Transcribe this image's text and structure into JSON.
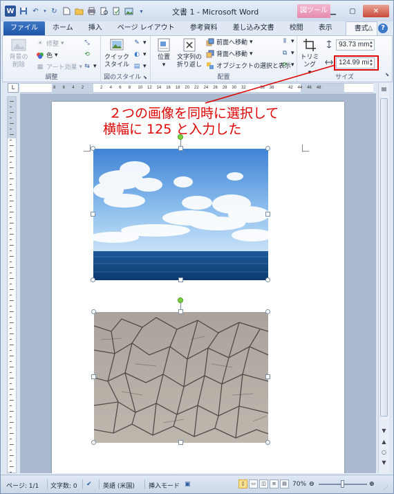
{
  "window": {
    "title": "文書 1 - Microsoft Word",
    "context_tab_title": "図ツール",
    "app_icon": "W"
  },
  "tabs": [
    {
      "label": "ファイル"
    },
    {
      "label": "ホーム"
    },
    {
      "label": "挿入"
    },
    {
      "label": "ページ レイアウト"
    },
    {
      "label": "参考資料"
    },
    {
      "label": "差し込み文書"
    },
    {
      "label": "校閲"
    },
    {
      "label": "表示"
    },
    {
      "label": "書式"
    }
  ],
  "ribbon": {
    "adjust": {
      "remove_bg": "背景の\n削除",
      "corrections": "修整",
      "color": "色",
      "artistic": "アート効果",
      "label": "調整"
    },
    "styles": {
      "quick_styles": "クイック\nスタイル",
      "label": "図のスタイル"
    },
    "arrange": {
      "position": "位置",
      "wrap_text": "文字列の\n折り返し",
      "bring_forward": "前面へ移動",
      "send_backward": "背面へ移動",
      "selection_pane": "オブジェクトの選択と表示",
      "label": "配置"
    },
    "size": {
      "crop": "トリミング",
      "height_value": "93.73 mm",
      "width_value": "124.99 mi",
      "label": "サイズ"
    }
  },
  "ruler": {
    "corner_label": "L",
    "h_numbers": [
      "8",
      "6",
      "4",
      "2",
      "",
      "2",
      "4",
      "6",
      "8",
      "10",
      "12",
      "14",
      "16",
      "18",
      "20",
      "22",
      "24",
      "26",
      "28",
      "30",
      "32",
      "",
      "36",
      "38",
      "",
      "42",
      "44",
      "46",
      "48"
    ]
  },
  "annotation": {
    "line1": "２つの画像を同時に選択して",
    "line2": "横幅に 125 と入力した"
  },
  "status": {
    "page": "ページ: 1/1",
    "words": "文字数: 0",
    "language": "英語 (米国)",
    "mode": "挿入モード",
    "zoom": "70%",
    "zoom_fraction": 0.5
  },
  "colors": {
    "annotation": "#e00000",
    "file_tab": "#2b5fae",
    "context_tab": "#e58bb0"
  }
}
